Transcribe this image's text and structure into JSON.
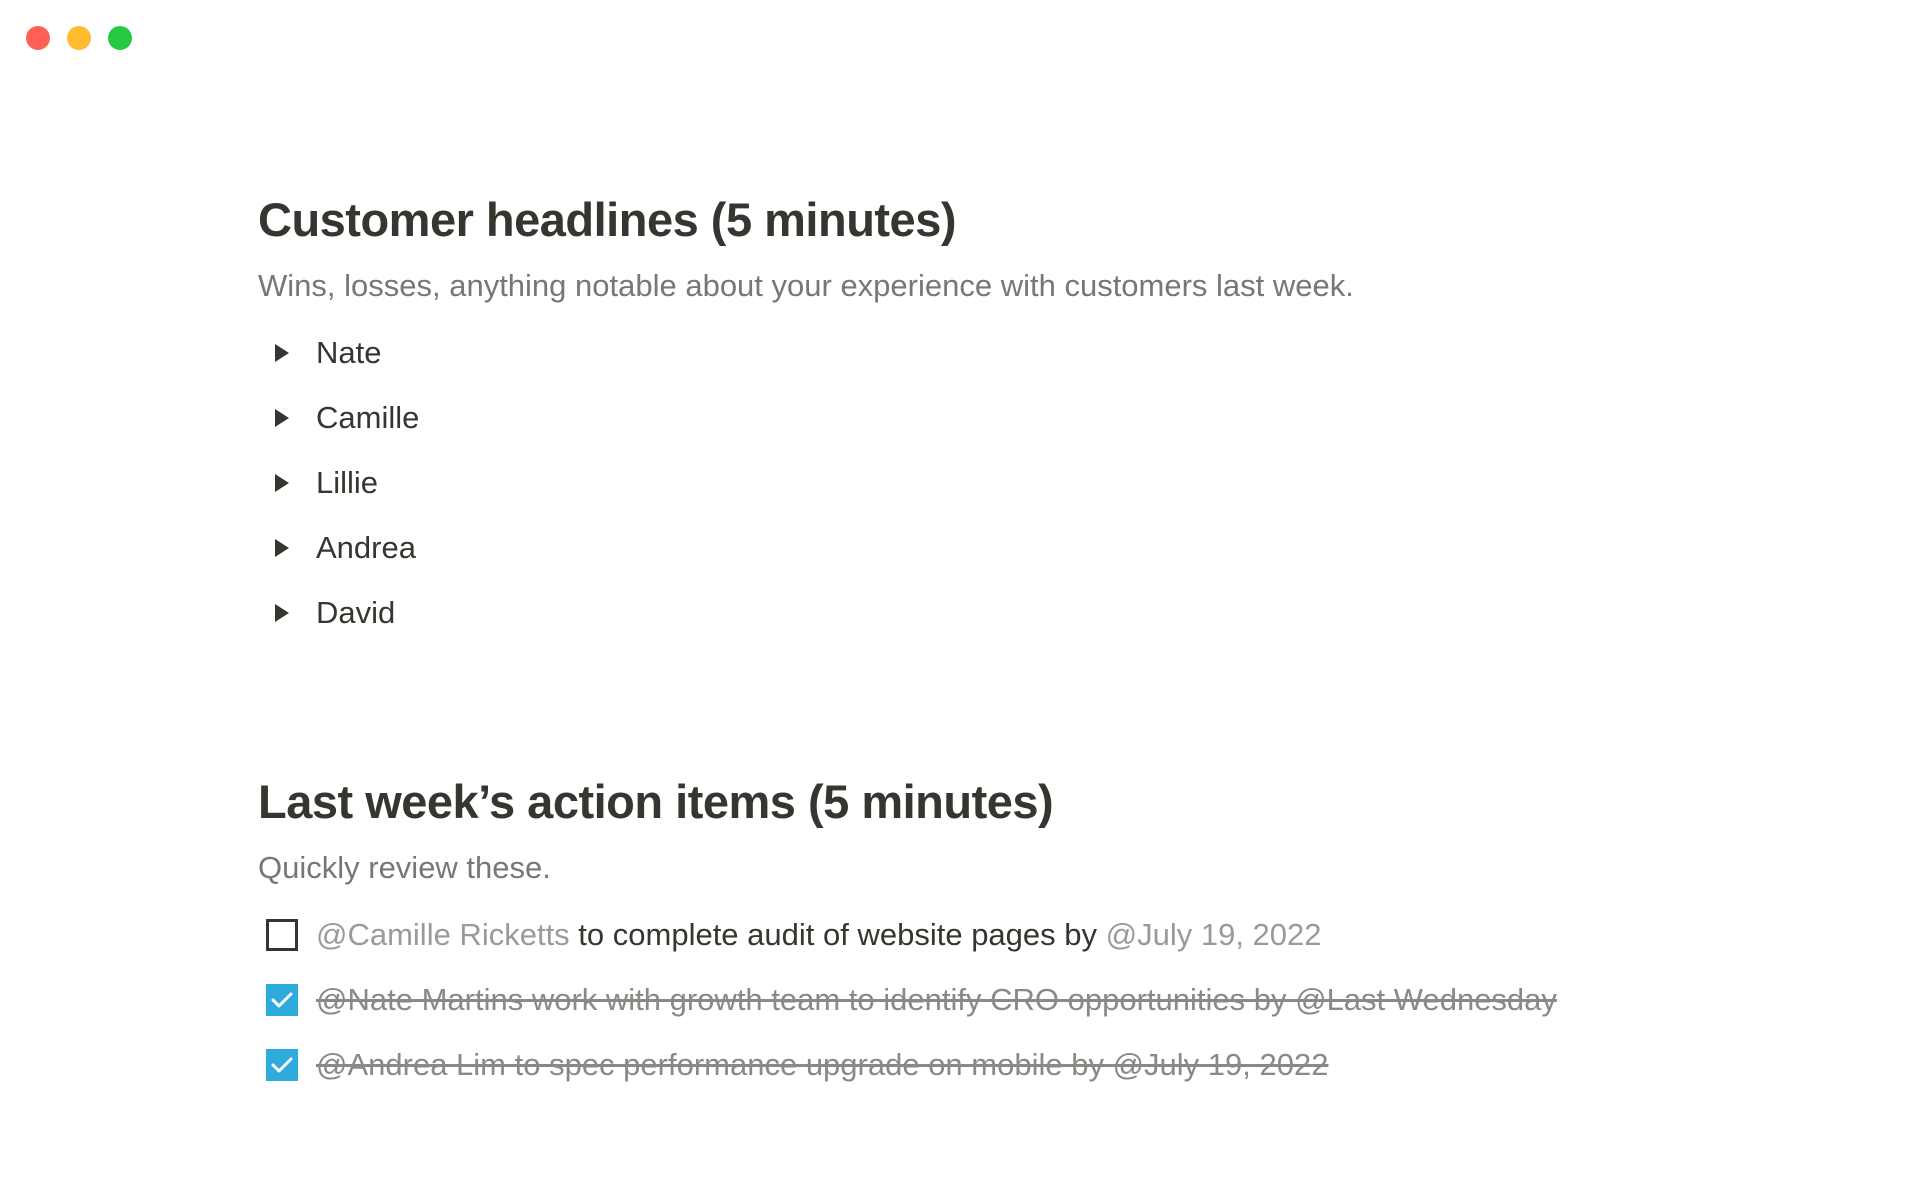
{
  "window": {
    "controls": [
      "close",
      "minimize",
      "maximize"
    ]
  },
  "colors": {
    "close": "#ff5f57",
    "minimize": "#febc2e",
    "maximize": "#28c840",
    "checkbox_checked": "#2eaadc",
    "text_primary": "#37352f",
    "text_secondary": "#787774"
  },
  "section1": {
    "title": "Customer headlines (5 minutes)",
    "description": "Wins, losses, anything notable about your experience with customers last week.",
    "toggles": [
      {
        "label": "Nate",
        "icon": "triangle-right-icon"
      },
      {
        "label": "Camille",
        "icon": "triangle-right-icon"
      },
      {
        "label": "Lillie",
        "icon": "triangle-right-icon"
      },
      {
        "label": "Andrea",
        "icon": "triangle-right-icon"
      },
      {
        "label": "David",
        "icon": "triangle-right-icon"
      }
    ]
  },
  "section2": {
    "title": "Last week’s action items (5 minutes)",
    "description": "Quickly review these.",
    "todos": [
      {
        "checked": false,
        "mention": "@Camille Ricketts",
        "text": " to complete audit of website pages by ",
        "date": "@July 19, 2022"
      },
      {
        "checked": true,
        "mention": "@Nate Martins",
        "text": " work with growth team to identify CRO opportunities by ",
        "date": "@Last Wednesday"
      },
      {
        "checked": true,
        "mention": "@Andrea Lim",
        "text": " to spec performance upgrade on mobile by ",
        "date": "@July 19, 2022"
      }
    ]
  }
}
